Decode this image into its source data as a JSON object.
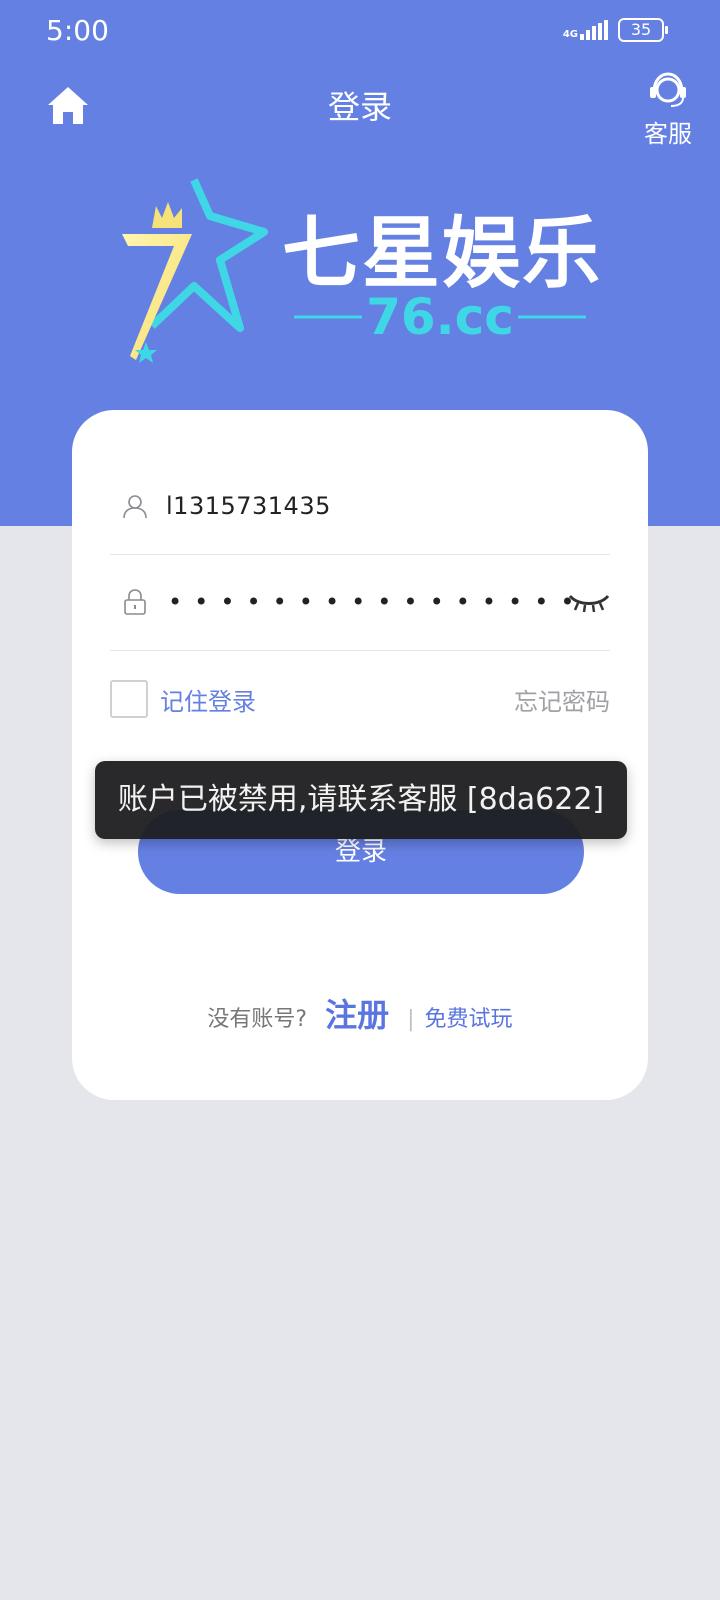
{
  "status_bar": {
    "time": "5:00",
    "network": "4G",
    "battery": "35"
  },
  "header": {
    "title": "登录",
    "support_label": "客服"
  },
  "logo": {
    "name": "七星娱乐",
    "domain": "76.cc"
  },
  "form": {
    "username_value": "l1315731435",
    "password_mask": "••••••••••••••••",
    "remember_label": "记住登录",
    "forgot_label": "忘记密码",
    "login_label": "登录"
  },
  "footer": {
    "no_account": "没有账号?",
    "register": "注册",
    "separator": "|",
    "trial": "免费试玩"
  },
  "toast": {
    "message": "账户已被禁用,请联系客服 [8da622]"
  },
  "colors": {
    "brand": "#6580e3",
    "background": "#e5e6eb"
  }
}
